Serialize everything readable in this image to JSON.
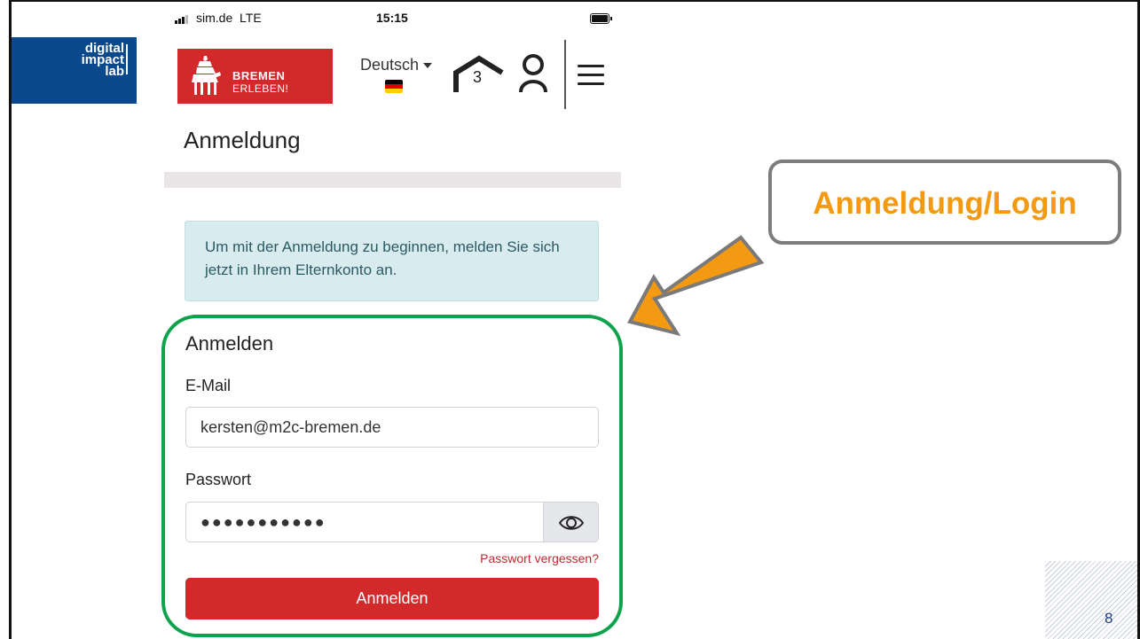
{
  "slide": {
    "page_number": "8",
    "callout_label": "Anmeldung/Login",
    "logo": {
      "line1": "digital",
      "line2": "impact",
      "line3": "lab"
    }
  },
  "statusbar": {
    "carrier": "sim.de",
    "network": "LTE",
    "time": "15:15"
  },
  "header": {
    "brand_line1": "BREMEN",
    "brand_line2": "ERLEBEN!",
    "language": "Deutsch",
    "cart_count": "3",
    "icons": [
      "house-icon",
      "user-icon",
      "hamburger-menu-icon",
      "eye-icon"
    ]
  },
  "page": {
    "title": "Anmeldung",
    "info": "Um mit der Anmeldung zu beginnen, melden Sie sich jetzt in Ihrem Elternkonto an."
  },
  "form": {
    "title": "Anmelden",
    "email_label": "E-Mail",
    "email_value": "kersten@m2c-bremen.de",
    "password_label": "Passwort",
    "password_value": "●●●●●●●●●●●",
    "forgot_link": "Passwort vergessen?",
    "submit_label": "Anmelden"
  },
  "colors": {
    "brand_red": "#d22a2a",
    "highlight_green": "#0ca34c",
    "callout_orange": "#f39a12",
    "info_background": "#d8ebee",
    "logo_blue": "#0a4a8c"
  }
}
